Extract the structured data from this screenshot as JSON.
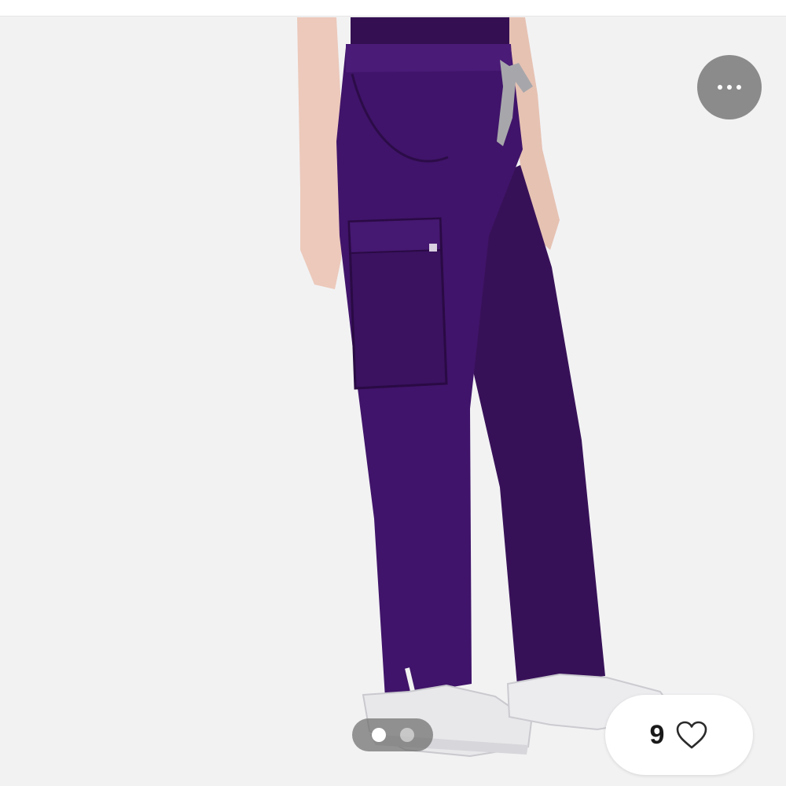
{
  "listing": {
    "image_subject": "purple-cargo-scrub-pants",
    "more_icon": "ellipsis-icon",
    "carousel": {
      "total": 2,
      "active": 1
    },
    "likes": {
      "count": "9",
      "icon": "heart-outline-icon"
    }
  },
  "colors": {
    "pants": "#3e1463",
    "background": "#f2f2f3",
    "drawstring": "#a7a7ab",
    "sneaker": "#e9e9ec",
    "skin": "#e9c7b8"
  }
}
